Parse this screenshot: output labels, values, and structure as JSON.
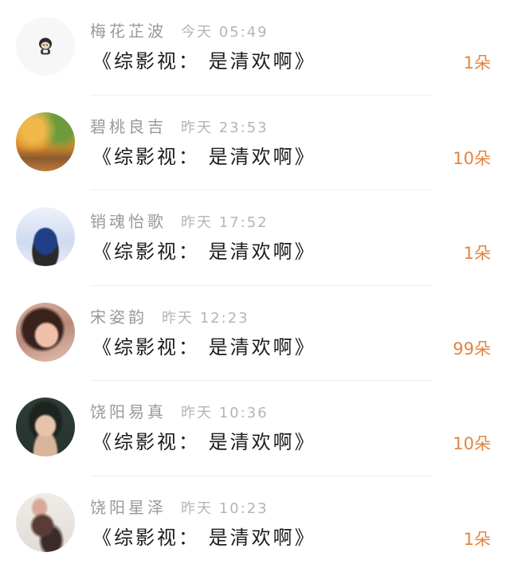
{
  "records": [
    {
      "name": "梅花芷波",
      "time": "今天 05:49",
      "content": "《综影视： 是清欢啊》",
      "count": "1朵"
    },
    {
      "name": "碧桃良吉",
      "time": "昨天 23:53",
      "content": "《综影视： 是清欢啊》",
      "count": "10朵"
    },
    {
      "name": "销魂怡歌",
      "time": "昨天 17:52",
      "content": "《综影视： 是清欢啊》",
      "count": "1朵"
    },
    {
      "name": "宋姿韵",
      "time": "昨天 12:23",
      "content": "《综影视： 是清欢啊》",
      "count": "99朵"
    },
    {
      "name": "饶阳易真",
      "time": "昨天 10:36",
      "content": "《综影视： 是清欢啊》",
      "count": "10朵"
    },
    {
      "name": "饶阳星泽",
      "time": "昨天 10:23",
      "content": "《综影视： 是清欢啊》",
      "count": "1朵"
    }
  ],
  "colors": {
    "name": "#9a9a9a",
    "time": "#b5b5b5",
    "content": "#1c1c1c",
    "count": "#e5843e",
    "divider": "#efefef"
  }
}
